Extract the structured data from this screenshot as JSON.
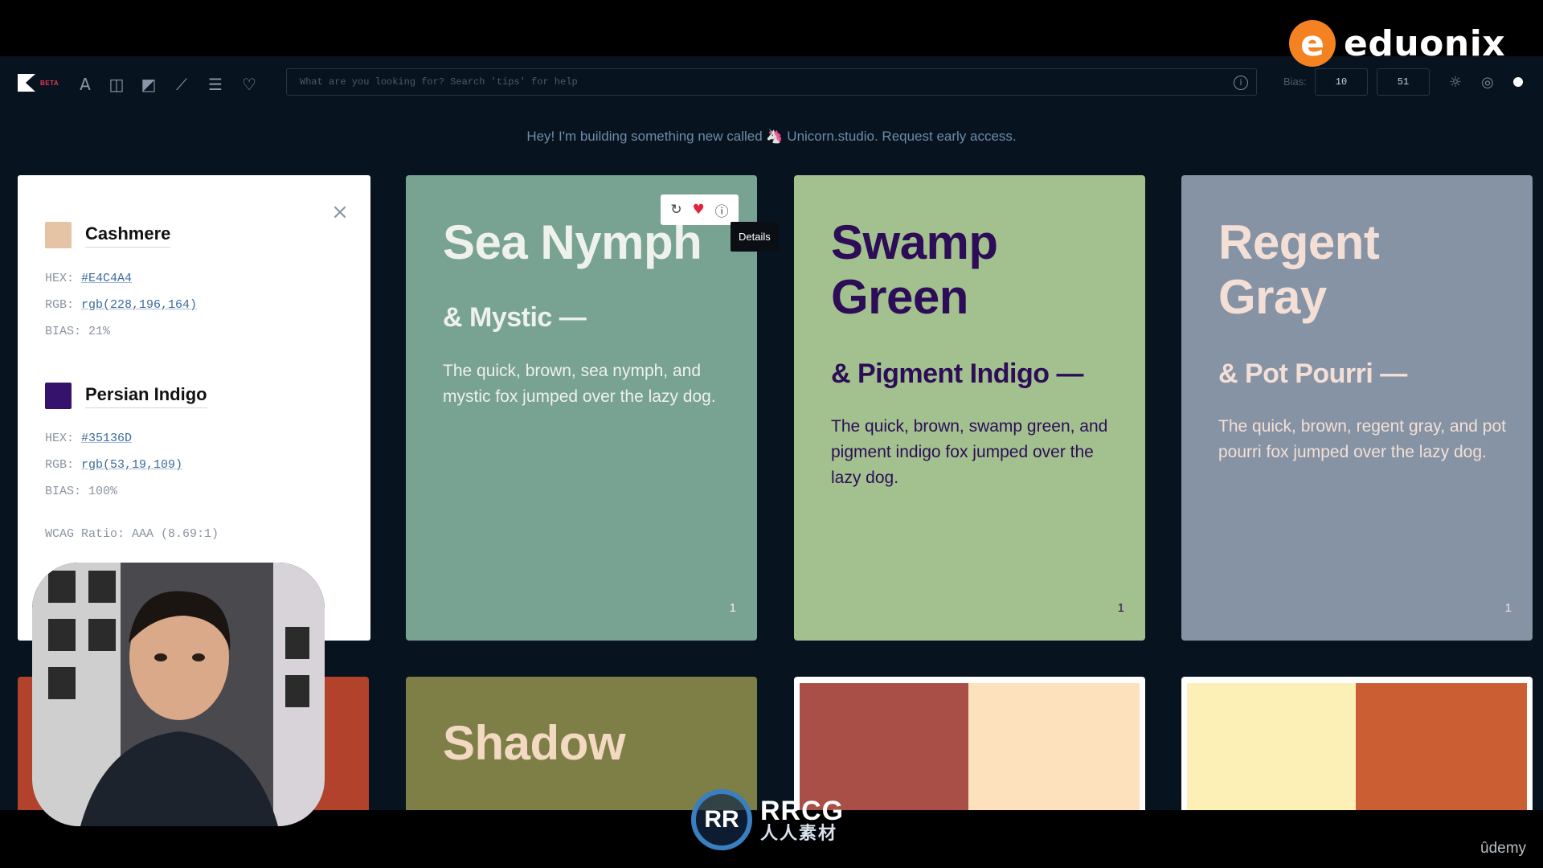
{
  "watermarks": {
    "eduonix_badge": "e",
    "eduonix_text": "eduonix",
    "rrcg_badge": "RR",
    "rrcg_en": "RRCG",
    "rrcg_cn": "人人素材",
    "udemy": "ûdemy"
  },
  "toolbar": {
    "beta": "BETA",
    "search_placeholder": "What are you looking for? Search 'tips' for help",
    "bias_label": "Bias:",
    "bias_a": "10",
    "bias_b": "51",
    "icons": [
      "text-icon",
      "columns-icon",
      "image-icon",
      "chart-icon",
      "list-icon",
      "heart-icon",
      "info-icon",
      "sun-icon",
      "target-icon",
      "dot-icon"
    ]
  },
  "announcement": {
    "text_before": "Hey! I'm building something new called",
    "link": "Unicorn.studio",
    "text_after": ". Request early access."
  },
  "details": {
    "colors": [
      {
        "name": "Cashmere",
        "swatch": "#E4C4A4",
        "hex_label": "HEX:",
        "hex": "#E4C4A4",
        "rgb_label": "RGB:",
        "rgb": "rgb(228,196,164)",
        "bias": "BIAS: 21%"
      },
      {
        "name": "Persian Indigo",
        "swatch": "#35136D",
        "hex_label": "HEX:",
        "hex": "#35136D",
        "rgb_label": "RGB:",
        "rgb": "rgb(53,19,109)",
        "bias": "BIAS: 100%"
      }
    ],
    "wcag": "WCAG Ratio: AAA (8.69:1)"
  },
  "cards": [
    {
      "title": "Sea Nymph",
      "subtitle": "& Mystic —",
      "text": "The quick, brown, sea nymph, and mystic fox jumped over the lazy dog.",
      "count": "1",
      "bg": "#78a292",
      "fg": "#eef1ec"
    },
    {
      "title": "Swamp Green",
      "subtitle": "& Pigment Indigo —",
      "text": "The quick, brown, swamp green, and pigment indigo fox jumped over the lazy dog.",
      "count": "1",
      "bg": "#a3c18e",
      "fg": "#2d0d57"
    },
    {
      "title": "Regent Gray",
      "subtitle": "& Pot Pourri —",
      "text": "The quick, brown, regent gray, and pot pourri fox jumped over the lazy dog.",
      "count": "1",
      "bg": "#8593a4",
      "fg": "#f4dfd6"
    }
  ],
  "hover_tooltip": "Details",
  "bottom_cards": [
    {
      "title": "",
      "bg": "#b3422c"
    },
    {
      "title": "Shadow",
      "bg": "#7e7f47",
      "fg": "#f3d9c2"
    },
    {
      "title": "",
      "left": "#a94f48",
      "right": "#fde1bd"
    },
    {
      "title": "",
      "left": "#fdf0b6",
      "right": "#cb5e33"
    }
  ]
}
